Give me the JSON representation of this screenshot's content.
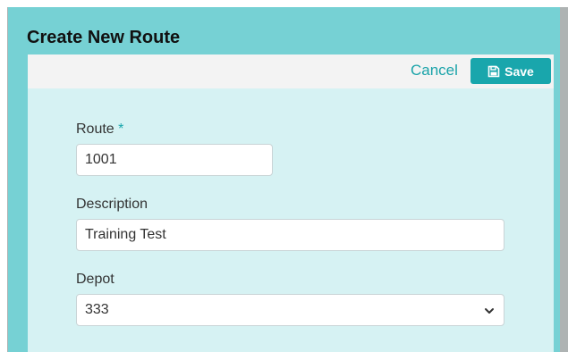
{
  "dialog": {
    "title": "Create New Route",
    "cancel_label": "Cancel",
    "save_label": "Save"
  },
  "form": {
    "route": {
      "label": "Route",
      "required_marker": "*",
      "value": "1001"
    },
    "description": {
      "label": "Description",
      "value": "Training Test"
    },
    "depot": {
      "label": "Depot",
      "value": "333"
    }
  },
  "icons": {
    "save": "floppy-disk-icon",
    "dropdown": "chevron-down-icon"
  },
  "colors": {
    "accent": "#19a6ac",
    "header_background": "#76d1d4",
    "content_background": "#d6f2f3"
  }
}
